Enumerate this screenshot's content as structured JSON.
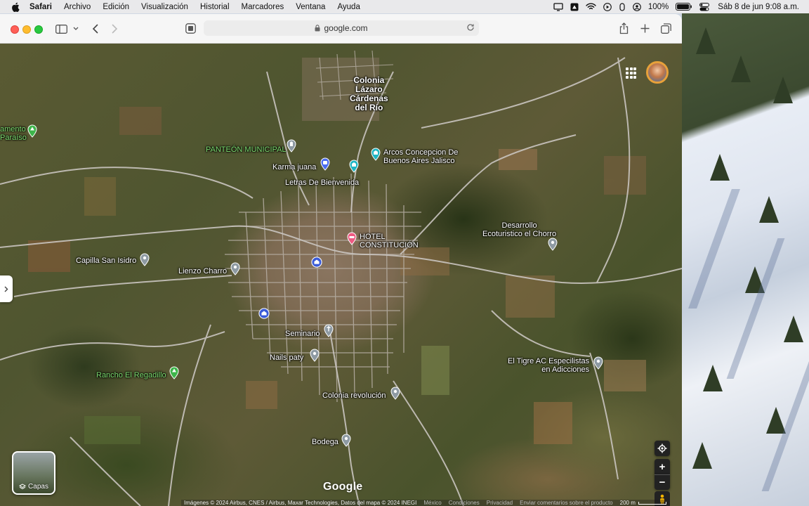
{
  "menubar": {
    "apple": "",
    "app": "Safari",
    "items": [
      "Archivo",
      "Edición",
      "Visualización",
      "Historial",
      "Marcadores",
      "Ventana",
      "Ayuda"
    ],
    "battery": "100%",
    "clock": "Sáb 8 de jun  9:08 a.m."
  },
  "browser": {
    "url": "google.com"
  },
  "map": {
    "places": [
      {
        "name": "Colonia Lázaro Cárdenas del Río",
        "kind": "area"
      },
      {
        "name": "PANTEÓN MUNICIPAL",
        "kind": "green"
      },
      {
        "name": "Karma juana",
        "kind": "shop"
      },
      {
        "name": "Arcos Concepcion De Buenos Aires Jalisco",
        "kind": "attraction"
      },
      {
        "name": "Letras De Bienvenida",
        "kind": "attraction"
      },
      {
        "name": "HOTEL CONSTITUCIÓN",
        "kind": "hotel"
      },
      {
        "name": "Desarrollo Ecoturistico el Chorro",
        "kind": "place"
      },
      {
        "name": "Capilla San Isidro",
        "kind": "place"
      },
      {
        "name": "Lienzo Charro",
        "kind": "place"
      },
      {
        "name": "Seminario",
        "kind": "place"
      },
      {
        "name": "Nails paty",
        "kind": "place"
      },
      {
        "name": "Rancho El Regadillo",
        "kind": "green"
      },
      {
        "name": "El Tigre AC Especilistas en Adicciones",
        "kind": "place"
      },
      {
        "name": "Colonia revolución",
        "kind": "place"
      },
      {
        "name": "Bodega",
        "kind": "place"
      },
      {
        "name": "amento Paraíso",
        "kind": "green"
      }
    ],
    "labels": {
      "colonia_lazaro_1": "Colonia",
      "colonia_lazaro_2": "Lázaro",
      "colonia_lazaro_3": "Cárdenas",
      "colonia_lazaro_4": "del Río",
      "panteon": "PANTEÓN MUNICIPAL",
      "karma": "Karma juana",
      "arcos_1": "Arcos Concepcion De",
      "arcos_2": "Buenos Aires Jalisco",
      "letras": "Letras De Bienvenida",
      "hotel_1": "HOTEL",
      "hotel_2": "CONSTITUCIÓN",
      "desarrollo_1": "Desarrollo",
      "desarrollo_2": "Ecoturistico el Chorro",
      "capilla": "Capilla San Isidro",
      "lienzo": "Lienzo Charro",
      "seminario": "Seminario",
      "nails": "Nails paty",
      "rancho": "Rancho El Regadillo",
      "tigre_1": "El Tigre AC Especilistas",
      "tigre_2": "en Adicciones",
      "colonia_rev": "Colonia revolución",
      "bodega": "Bodega",
      "paraiso_1": "amento",
      "paraiso_2": "Paraíso"
    },
    "layers_label": "Capas",
    "logo": "Google",
    "zoom_in": "+",
    "zoom_out": "−",
    "attribution": {
      "imagery": "Imágenes © 2024 Airbus, CNES / Airbus, Maxar Technologies, Datos del mapa © 2024 INEGI",
      "region": "México",
      "terms": "Condiciones",
      "privacy": "Privacidad",
      "feedback": "Enviar comentarios sobre el producto",
      "scale": "200 m"
    }
  },
  "colors": {
    "pin_gray": "#8e9aa3",
    "pin_teal": "#1fb5c4",
    "pin_blue": "#4a6cf0",
    "pin_pink": "#ee5a82",
    "pin_green": "#3db54a",
    "label_green": "#7ddc6f"
  }
}
